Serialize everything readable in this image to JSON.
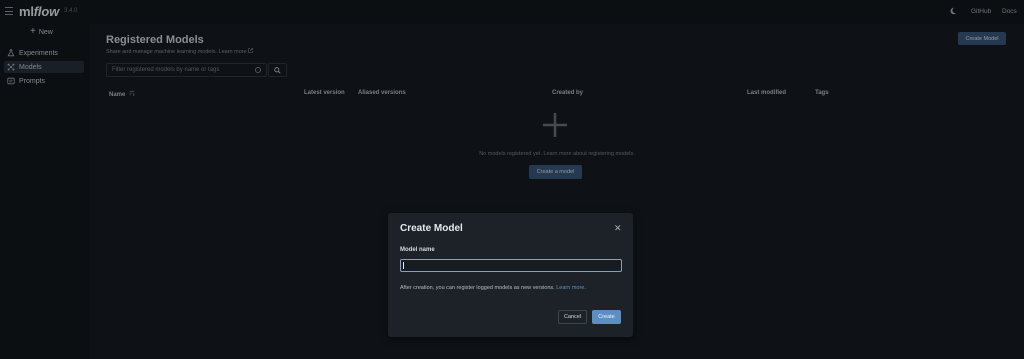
{
  "app": {
    "logo_ml": "ml",
    "logo_flow": "flow",
    "version": "3.4.0"
  },
  "topbar": {
    "github_label": "GitHub",
    "docs_label": "Docs"
  },
  "sidebar": {
    "new_label": "New",
    "items": [
      {
        "label": "Experiments",
        "icon": "beaker-icon",
        "active": false
      },
      {
        "label": "Models",
        "icon": "models-icon",
        "active": true
      },
      {
        "label": "Prompts",
        "icon": "prompts-icon",
        "active": false
      }
    ]
  },
  "main": {
    "title": "Registered Models",
    "description": "Share and manage machine learning models.",
    "learn_more": "Learn more",
    "create_model_label": "Create Model",
    "filter_placeholder": "Filter registered models by name or tags",
    "columns": [
      "Name",
      "Latest version",
      "Aliased versions",
      "Created by",
      "Last modified",
      "Tags"
    ],
    "empty_text": "No models registered yet. Learn more about registering models.",
    "create_a_model_label": "Create a model"
  },
  "modal": {
    "title": "Create Model",
    "field_label": "Model name",
    "input_value": "",
    "hint": "After creation, you can register logged models as new versions.",
    "hint_link": "Learn more",
    "cancel_label": "Cancel",
    "create_label": "Create"
  },
  "colors": {
    "accent": "#5b8fc4",
    "background": "#161c22",
    "sidebar": "#11171c"
  }
}
